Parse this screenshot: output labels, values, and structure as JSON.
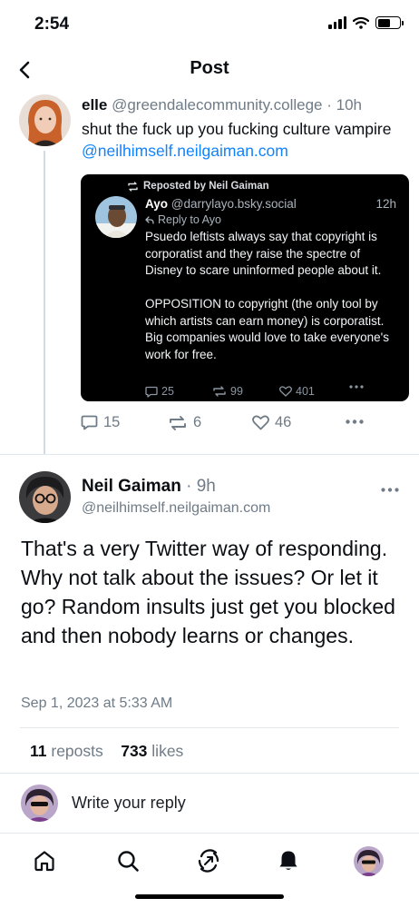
{
  "status_bar": {
    "time": "2:54"
  },
  "header": {
    "title": "Post"
  },
  "parent_post": {
    "author_name": "elle",
    "author_handle": "@greendalecommunity.college",
    "separator": "·",
    "time": "10h",
    "text": "shut the fuck up you fucking culture vampire ",
    "mention": "@neilhimself.neilgaiman.com",
    "quote": {
      "repost_label": "Reposted by Neil Gaiman",
      "author_name": "Ayo",
      "author_handle": "@darrylayo.bsky.social",
      "time": "12h",
      "reply_label": "Reply to Ayo",
      "text": "Psuedo leftists always say that copyright is corporatist and they raise the spectre of Disney to scare uninformed people about it.\n\nOPPOSITION to copyright (the only tool by which artists can earn money) is corporatist. Big companies would love to take everyone's work for free.",
      "replies": "25",
      "reposts": "99",
      "likes": "401"
    },
    "replies": "15",
    "reposts": "6",
    "likes": "46"
  },
  "main_post": {
    "author_name": "Neil Gaiman",
    "separator": "·",
    "time": "9h",
    "author_handle": "@neilhimself.neilgaiman.com",
    "text": "That's a very Twitter way of responding. Why not talk about the issues? Or let it go? Random insults just get you blocked and then nobody learns or changes.",
    "date": "Sep 1, 2023 at 5:33 AM",
    "reposts_count": "11",
    "reposts_label": "reposts",
    "likes_count": "733",
    "likes_label": "likes"
  },
  "reply_bar": {
    "placeholder": "Write your reply"
  },
  "tabs": [
    {
      "name": "home",
      "icon": "home-icon"
    },
    {
      "name": "search",
      "icon": "search-icon"
    },
    {
      "name": "feeds",
      "icon": "feeds-icon"
    },
    {
      "name": "notifications",
      "icon": "bell-icon"
    },
    {
      "name": "profile",
      "icon": "avatar"
    }
  ],
  "colors": {
    "accent": "#1083fe",
    "muted": "#6f7b86",
    "quote_bg": "#000000"
  }
}
